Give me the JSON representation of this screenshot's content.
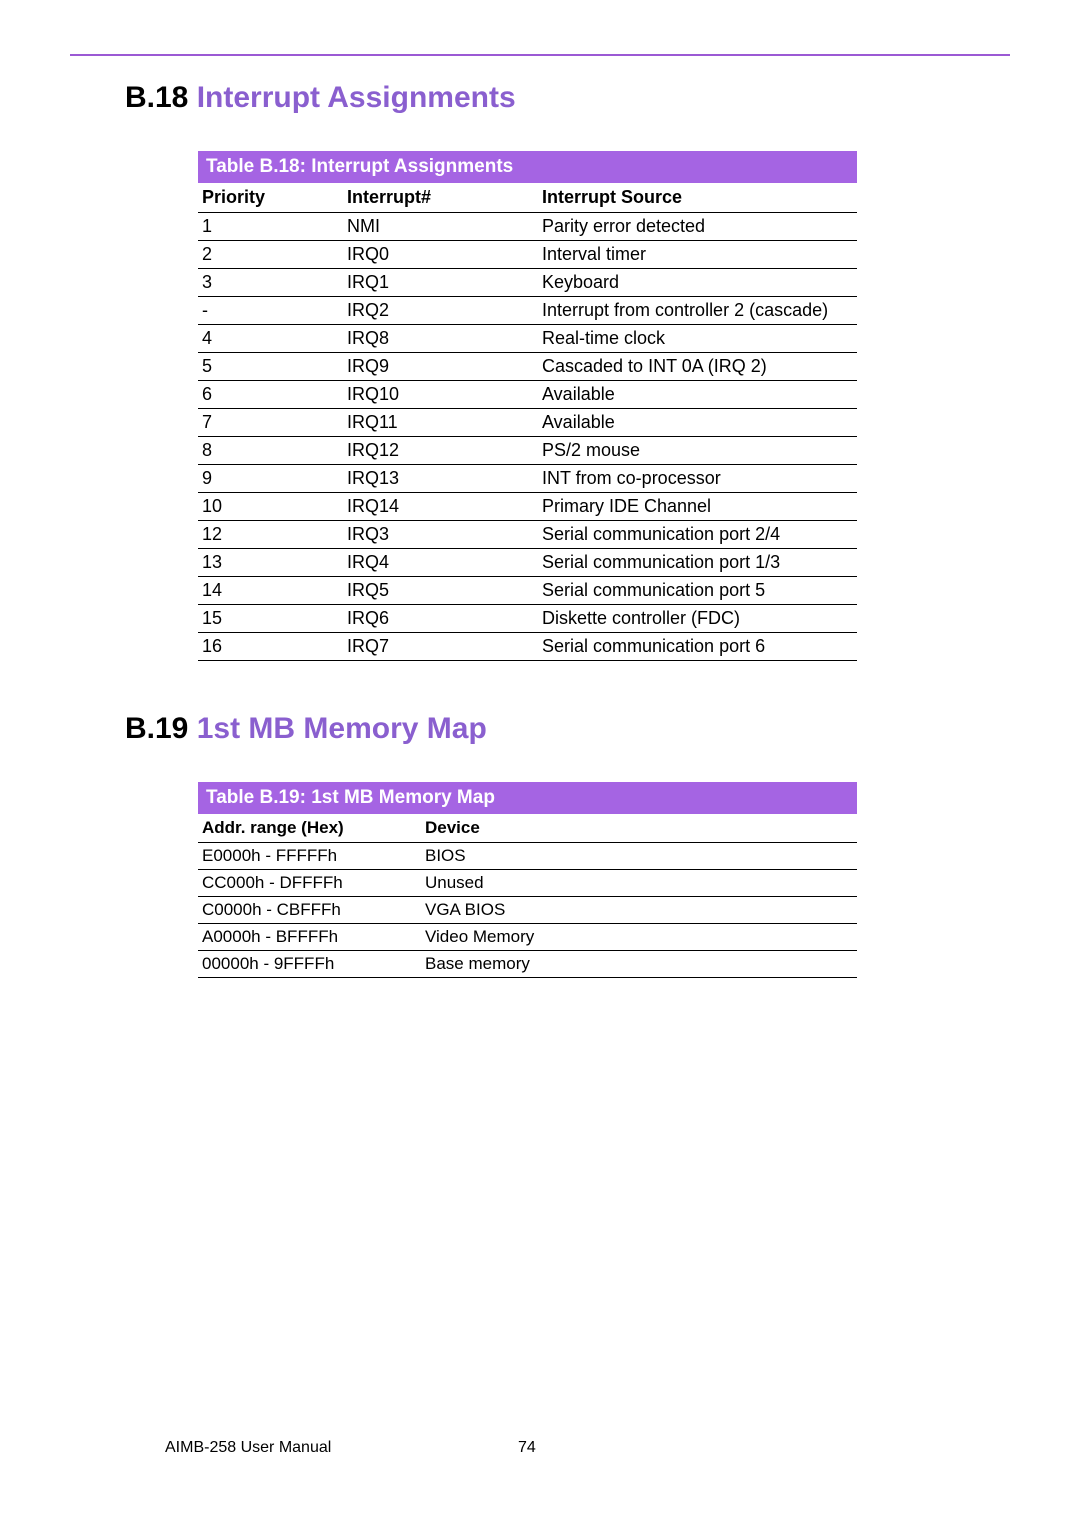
{
  "sections": {
    "s1": {
      "num": "B.18",
      "title": "Interrupt Assignments"
    },
    "s2": {
      "num": "B.19",
      "title": "1st MB Memory Map"
    }
  },
  "table1": {
    "caption": "Table B.18: Interrupt Assignments",
    "headers": {
      "c1": "Priority",
      "c2": "Interrupt#",
      "c3": "Interrupt Source"
    },
    "rows": [
      {
        "c1": "1",
        "c2": "NMI",
        "c3": "Parity error detected"
      },
      {
        "c1": "2",
        "c2": "IRQ0",
        "c3": "Interval timer"
      },
      {
        "c1": "3",
        "c2": "IRQ1",
        "c3": "Keyboard"
      },
      {
        "c1": "-",
        "c2": "IRQ2",
        "c3": "Interrupt from controller 2 (cascade)"
      },
      {
        "c1": "4",
        "c2": "IRQ8",
        "c3": "Real-time clock"
      },
      {
        "c1": "5",
        "c2": "IRQ9",
        "c3": "Cascaded to INT 0A (IRQ 2)"
      },
      {
        "c1": "6",
        "c2": "IRQ10",
        "c3": "Available"
      },
      {
        "c1": "7",
        "c2": "IRQ11",
        "c3": "Available"
      },
      {
        "c1": "8",
        "c2": "IRQ12",
        "c3": "PS/2 mouse"
      },
      {
        "c1": "9",
        "c2": "IRQ13",
        "c3": "INT from co-processor"
      },
      {
        "c1": "10",
        "c2": "IRQ14",
        "c3": "Primary IDE Channel"
      },
      {
        "c1": "12",
        "c2": "IRQ3",
        "c3": "Serial communication port 2/4"
      },
      {
        "c1": "13",
        "c2": "IRQ4",
        "c3": "Serial communication port 1/3"
      },
      {
        "c1": "14",
        "c2": "IRQ5",
        "c3": "Serial communication port 5"
      },
      {
        "c1": "15",
        "c2": "IRQ6",
        "c3": "Diskette controller (FDC)"
      },
      {
        "c1": "16",
        "c2": "IRQ7",
        "c3": "Serial communication port 6"
      }
    ]
  },
  "table2": {
    "caption": "Table B.19: 1st MB Memory Map",
    "headers": {
      "c1": "Addr. range (Hex)",
      "c2": "Device"
    },
    "rows": [
      {
        "c1": "E0000h - FFFFFh",
        "c2": "BIOS"
      },
      {
        "c1": "CC000h - DFFFFh",
        "c2": "Unused"
      },
      {
        "c1": "C0000h - CBFFFh",
        "c2": "VGA BIOS"
      },
      {
        "c1": "A0000h - BFFFFh",
        "c2": "Video Memory"
      },
      {
        "c1": "00000h - 9FFFFh",
        "c2": "Base memory"
      }
    ]
  },
  "footer": {
    "manual": "AIMB-258 User Manual",
    "page": "74"
  }
}
